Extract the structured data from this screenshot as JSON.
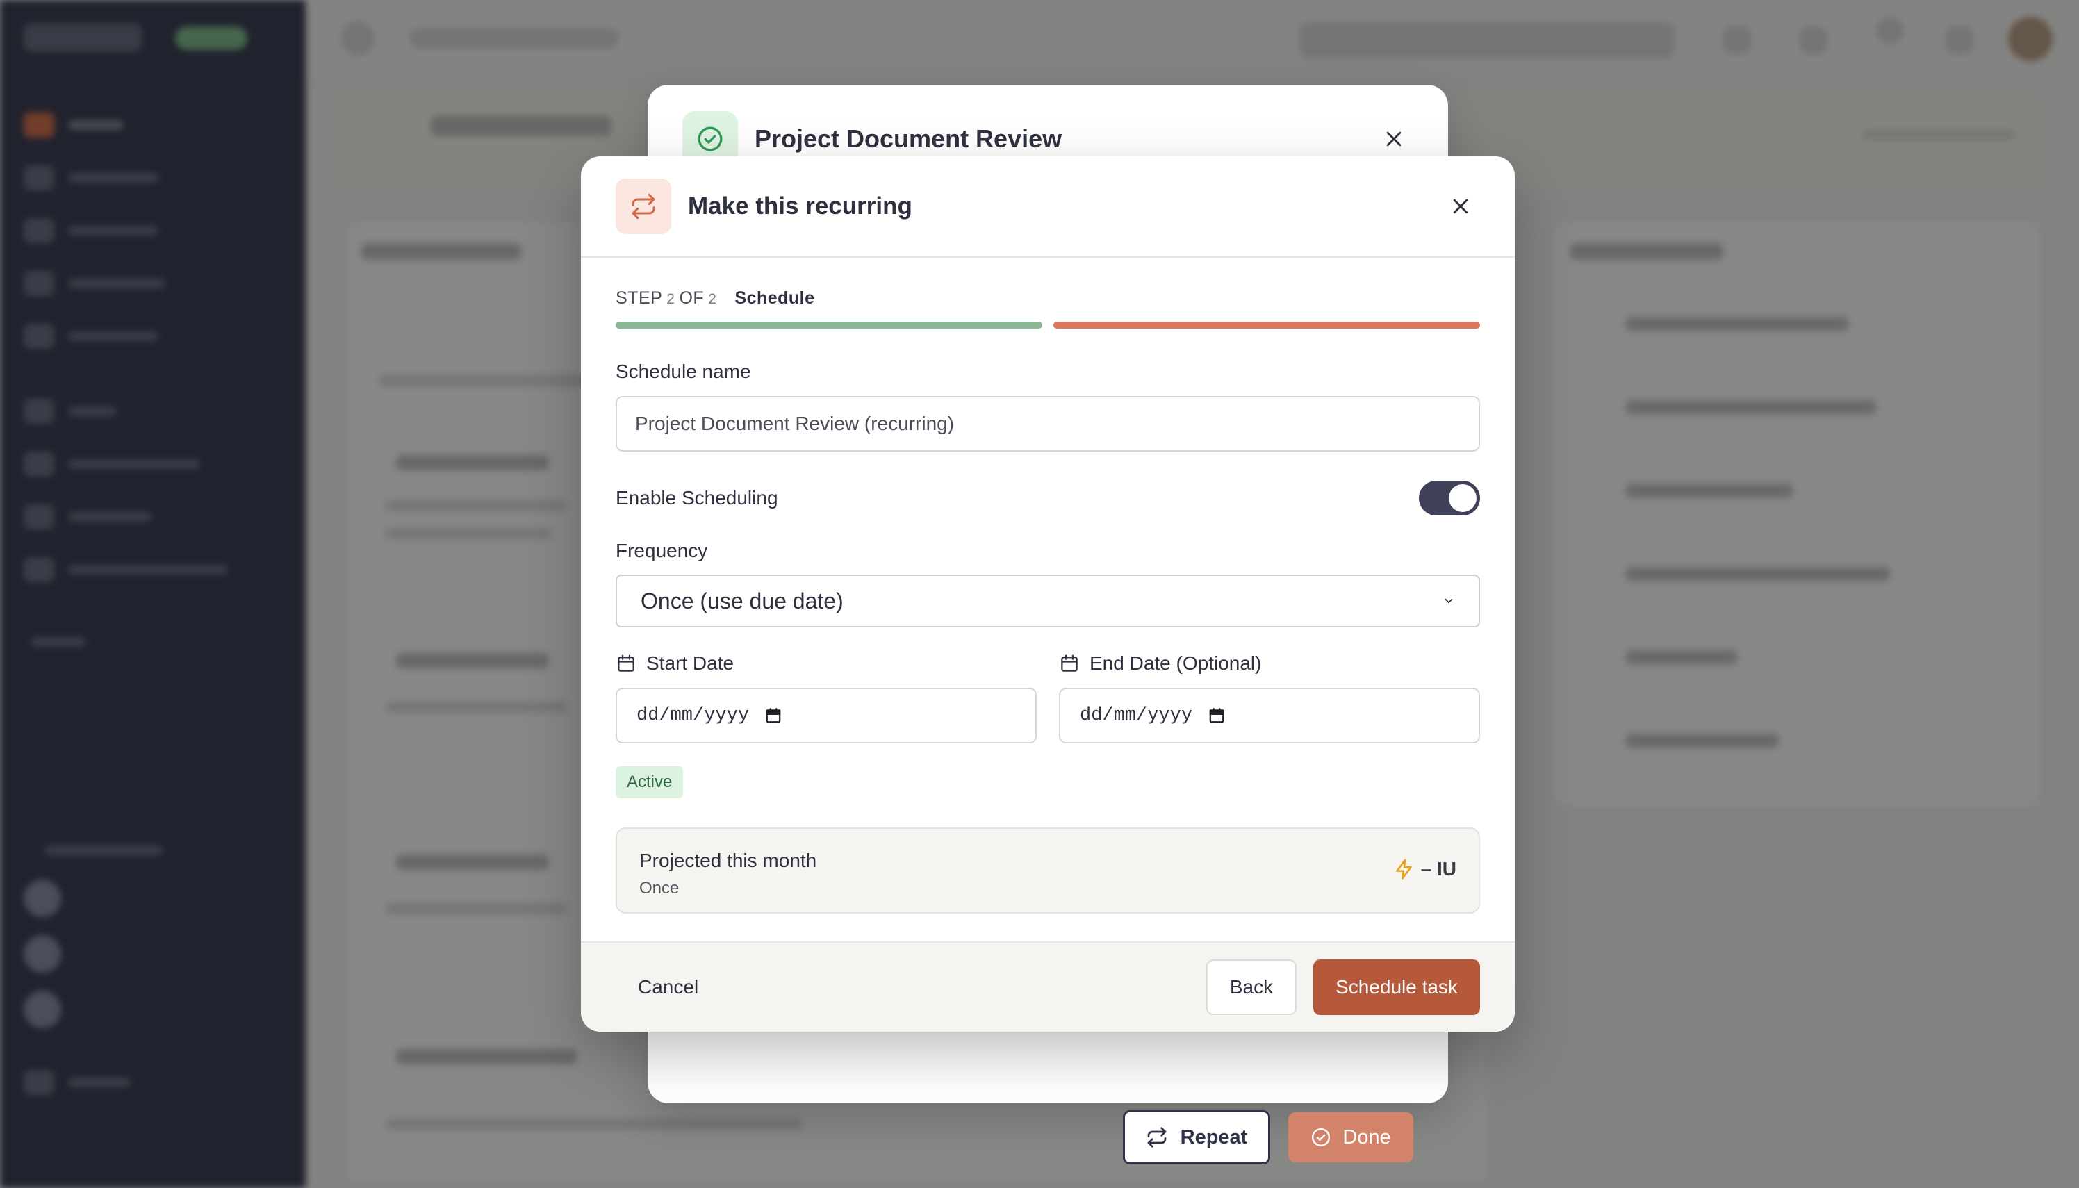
{
  "colors": {
    "accent": "#b6593b",
    "success": "#2e6b40",
    "progress_done": "#8db895",
    "progress_current": "#d77a5c",
    "toggle_on": "#3e4157",
    "bolt": "#e9a21b"
  },
  "parent_modal": {
    "title": "Project Document Review",
    "icon": "check-circle-icon",
    "repeat_label": "Repeat",
    "done_label": "Done"
  },
  "modal": {
    "title": "Make this recurring",
    "icon": "repeat-icon",
    "step": {
      "prefix": "STEP",
      "current": "2",
      "of": "OF",
      "total": "2",
      "name": "Schedule",
      "progress": [
        1,
        1
      ]
    },
    "schedule_name": {
      "label": "Schedule name",
      "value": "Project Document Review (recurring)"
    },
    "enable_scheduling": {
      "label": "Enable Scheduling",
      "enabled": true
    },
    "frequency": {
      "label": "Frequency",
      "selected": "Once (use due date)"
    },
    "start_date": {
      "label": "Start Date",
      "placeholder": "dd/mm/yyyy"
    },
    "end_date": {
      "label": "End Date (Optional)",
      "placeholder": "dd/mm/yyyy"
    },
    "status_badge": "Active",
    "projection": {
      "title": "Projected this month",
      "subtitle": "Once",
      "value": "– IU"
    },
    "footer": {
      "cancel": "Cancel",
      "back": "Back",
      "submit": "Schedule task"
    }
  }
}
